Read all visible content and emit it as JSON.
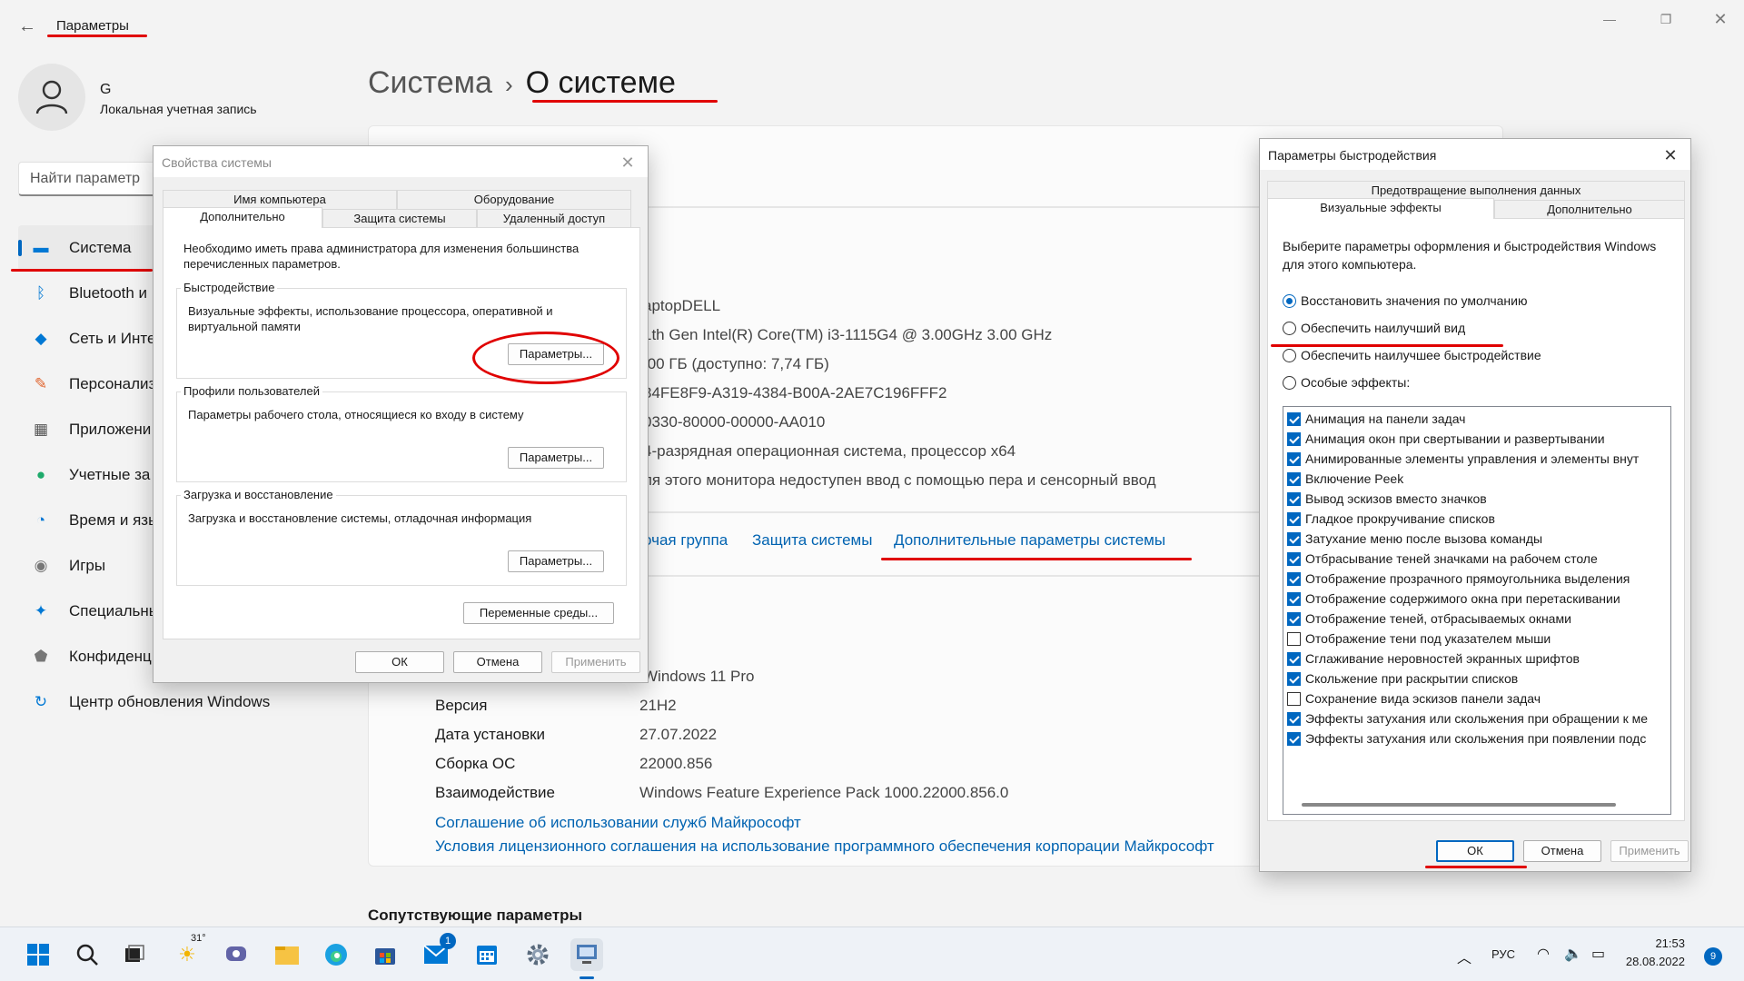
{
  "window": {
    "title": "Параметры"
  },
  "user": {
    "name": "G",
    "type": "Локальная учетная запись"
  },
  "search": {
    "placeholder": "Найти параметр"
  },
  "nav": [
    {
      "label": "Система",
      "icon": "display-icon",
      "color": "#0078d4"
    },
    {
      "label": "Bluetooth и",
      "icon": "bluetooth-icon",
      "color": "#0078d4"
    },
    {
      "label": "Сеть и Инте",
      "icon": "wifi-icon",
      "color": "#0078d4"
    },
    {
      "label": "Персонализ",
      "icon": "brush-icon",
      "color": "#e0622b"
    },
    {
      "label": "Приложени",
      "icon": "apps-icon",
      "color": "#555555"
    },
    {
      "label": "Учетные за",
      "icon": "person-icon",
      "color": "#1eaa6b"
    },
    {
      "label": "Время и язы",
      "icon": "globe-clock-icon",
      "color": "#0078d4"
    },
    {
      "label": "Игры",
      "icon": "gamepad-icon",
      "color": "#777777"
    },
    {
      "label": "Специальны",
      "icon": "accessibility-icon",
      "color": "#0078d4"
    },
    {
      "label": "Конфиденц",
      "icon": "shield-icon",
      "color": "#777777"
    },
    {
      "label": "Центр обновления Windows",
      "icon": "update-icon",
      "color": "#0078d4"
    }
  ],
  "breadcrumb": {
    "parent": "Система",
    "sep": "›",
    "current": "О системе"
  },
  "device_specs": [
    "aptopDELL",
    "1th Gen Intel(R) Core(TM) i3-1115G4 @ 3.00GHz   3.00 GHz",
    ",00 ГБ (доступно: 7,74 ГБ)",
    "84FE8F9-A319-4384-B00A-2AE7C196FFF2",
    "0330-80000-00000-AA010",
    "4-разрядная операционная система, процессор x64",
    "ля этого монитора недоступен ввод с помощью пера и сенсорный ввод"
  ],
  "related_links": {
    "partial": "очая группа",
    "protection": "Защита системы",
    "advanced": "Дополнительные параметры системы"
  },
  "windows_specs": {
    "edition_value": "Windows 11 Pro",
    "rows": [
      {
        "label": "Версия",
        "value": "21H2"
      },
      {
        "label": "Дата установки",
        "value": "27.07.2022"
      },
      {
        "label": "Сборка ОС",
        "value": "22000.856"
      },
      {
        "label": "Взаимодействие",
        "value": "Windows Feature Experience Pack 1000.22000.856.0"
      }
    ],
    "link1": "Соглашение об использовании служб Майкрософт",
    "link2": "Условия лицензионного соглашения на использование программного обеспечения корпорации Майкрософт"
  },
  "related_heading": "Сопутствующие параметры",
  "sysprops": {
    "title": "Свойства системы",
    "tabs_top": [
      "Имя компьютера",
      "Оборудование"
    ],
    "tabs_bottom": [
      "Дополнительно",
      "Защита системы",
      "Удаленный доступ"
    ],
    "admin_note": "Необходимо иметь права администратора для изменения большинства перечисленных параметров.",
    "perf": {
      "title": "Быстродействие",
      "desc": "Визуальные эффекты, использование процессора, оперативной и виртуальной памяти",
      "btn": "Параметры..."
    },
    "profiles": {
      "title": "Профили пользователей",
      "desc": "Параметры рабочего стола, относящиеся ко входу в систему",
      "btn": "Параметры..."
    },
    "startup": {
      "title": "Загрузка и восстановление",
      "desc": "Загрузка и восстановление системы, отладочная информация",
      "btn": "Параметры..."
    },
    "env_btn": "Переменные среды...",
    "ok": "ОК",
    "cancel": "Отмена",
    "apply": "Применить"
  },
  "perfopts": {
    "title": "Параметры быстродействия",
    "tab_top": "Предотвращение выполнения данных",
    "tabs_bottom": [
      "Визуальные эффекты",
      "Дополнительно"
    ],
    "intro": "Выберите параметры оформления и быстродействия Windows для этого компьютера.",
    "radios": [
      {
        "label": "Восстановить значения по умолчанию",
        "checked": true
      },
      {
        "label": "Обеспечить наилучший вид",
        "checked": false
      },
      {
        "label": "Обеспечить наилучшее быстродействие",
        "checked": false
      },
      {
        "label": "Особые эффекты:",
        "checked": false
      }
    ],
    "effects": [
      {
        "label": "Анимация на панели задач",
        "checked": true
      },
      {
        "label": "Анимация окон при свертывании и развертывании",
        "checked": true
      },
      {
        "label": "Анимированные элементы управления и элементы внут",
        "checked": true
      },
      {
        "label": "Включение Peek",
        "checked": true
      },
      {
        "label": "Вывод эскизов вместо значков",
        "checked": true
      },
      {
        "label": "Гладкое прокручивание списков",
        "checked": true
      },
      {
        "label": "Затухание меню после вызова команды",
        "checked": true
      },
      {
        "label": "Отбрасывание теней значками на рабочем столе",
        "checked": true
      },
      {
        "label": "Отображение прозрачного прямоугольника выделения",
        "checked": true
      },
      {
        "label": "Отображение содержимого окна при перетаскивании",
        "checked": true
      },
      {
        "label": "Отображение теней, отбрасываемых окнами",
        "checked": true
      },
      {
        "label": "Отображение тени под указателем мыши",
        "checked": false
      },
      {
        "label": "Сглаживание неровностей экранных шрифтов",
        "checked": true
      },
      {
        "label": "Скольжение при раскрытии списков",
        "checked": true
      },
      {
        "label": "Сохранение вида эскизов панели задач",
        "checked": false
      },
      {
        "label": "Эффекты затухания или скольжения при обращении к ме",
        "checked": true
      },
      {
        "label": "Эффекты затухания или скольжения при появлении подс",
        "checked": true
      }
    ],
    "ok": "ОК",
    "cancel": "Отмена",
    "apply": "Применить"
  },
  "taskbar": {
    "weather_temp": "31°",
    "mail_badge": "1",
    "lang": "РУС",
    "time": "21:53",
    "date": "28.08.2022",
    "notif_count": "9"
  }
}
